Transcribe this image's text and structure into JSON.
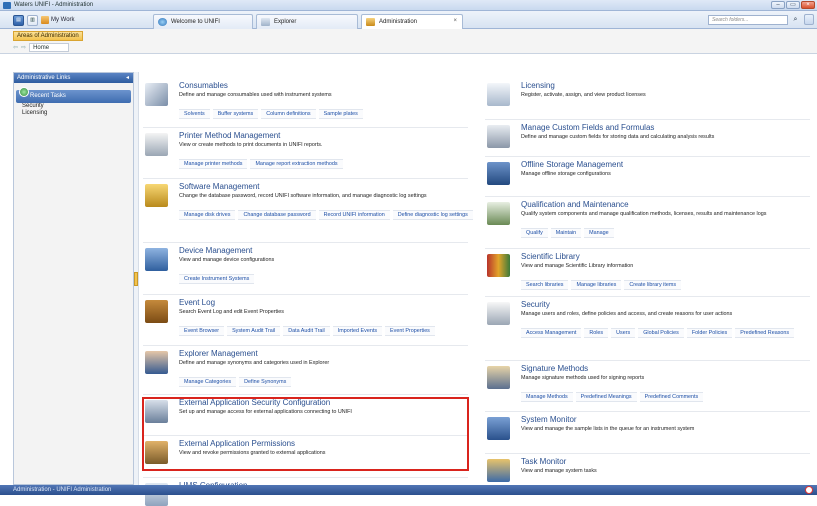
{
  "window": {
    "title": "Waters UNIFI - Administration",
    "controls": [
      "–",
      "▭",
      "×"
    ]
  },
  "toolbar": {
    "view_btn": "▤",
    "layout_btn": "▥",
    "my_work_label": "My Work",
    "tabs": [
      {
        "label": "Welcome to UNIFI"
      },
      {
        "label": "Explorer"
      },
      {
        "label": "Administration"
      }
    ],
    "tab_close": "×",
    "search_placeholder": "Search folders..."
  },
  "areas": {
    "label": "Areas of Administration",
    "back": "⇦",
    "forward": "⇨",
    "home": "Home"
  },
  "sidebar": {
    "header": "Administrative Links",
    "pin": "◂",
    "recent_tasks": "Recent Tasks",
    "links": [
      "Security",
      "Licensing"
    ]
  },
  "sections_left": [
    {
      "title": "Consumables",
      "desc": "Define and manage consumables used with instrument systems",
      "links": [
        "Solvents",
        "Buffer systems",
        "Column definitions",
        "Sample plates"
      ]
    },
    {
      "title": "Printer Method Management",
      "desc": "View or create methods to print documents in UNIFI reports.",
      "links": [
        "Manage printer methods",
        "Manage report extraction methods"
      ]
    },
    {
      "title": "Software Management",
      "desc": "Change the database password, record UNIFI software information, and manage diagnostic log settings",
      "links": [
        "Manage disk drives",
        "Change database password",
        "Record UNIFI information",
        "Define diagnostic log settings"
      ]
    },
    {
      "title": "Device Management",
      "desc": "View and manage device configurations",
      "links": [
        "Create Instrument Systems"
      ]
    },
    {
      "title": "Event Log",
      "desc": "Search Event Log and edit Event Properties",
      "links": [
        "Event Browser",
        "System Audit Trail",
        "Data Audit Trail",
        "Imported Events",
        "Event Properties"
      ]
    },
    {
      "title": "Explorer Management",
      "desc": "Define and manage synonyms and categories used in Explorer",
      "links": [
        "Manage Categories",
        "Define Synonyms"
      ]
    },
    {
      "title": "External Application Security Configuration",
      "desc": "Set up and manage access for external applications connecting to UNIFI",
      "links": []
    },
    {
      "title": "External Application Permissions",
      "desc": "View and revoke permissions granted to external applications",
      "links": []
    },
    {
      "title": "LIMS Configuration",
      "desc": "",
      "links": []
    }
  ],
  "sections_right": [
    {
      "title": "Licensing",
      "desc": "Register, activate, assign, and view product licenses",
      "links": []
    },
    {
      "title": "Manage Custom Fields and Formulas",
      "desc": "Define and manage custom fields for storing data and calculating analysis results",
      "links": []
    },
    {
      "title": "Offline Storage Management",
      "desc": "Manage offline storage configurations",
      "links": []
    },
    {
      "title": "Qualification and Maintenance",
      "desc": "Qualify system components and manage qualification methods, licenses, results and maintenance logs",
      "links": [
        "Qualify",
        "Maintain",
        "Manage"
      ]
    },
    {
      "title": "Scientific Library",
      "desc": "View and manage Scientific Library information",
      "links": [
        "Search libraries",
        "Manage libraries",
        "Create library items"
      ]
    },
    {
      "title": "Security",
      "desc": "Manage users and roles, define policies and access, and create reasons for user actions",
      "links": [
        "Access Management",
        "Roles",
        "Users",
        "Global Policies",
        "Folder Policies",
        "Predefined Reasons"
      ]
    },
    {
      "title": "Signature Methods",
      "desc": "Manage signature methods used for signing reports",
      "links": [
        "Manage Methods",
        "Predefined Meanings",
        "Predefined Comments"
      ]
    },
    {
      "title": "System Monitor",
      "desc": "View and manage the sample lists in the queue for an instrument system",
      "links": []
    },
    {
      "title": "Task Monitor",
      "desc": "View and manage system tasks",
      "links": []
    }
  ],
  "statusbar": {
    "text": "Administration - UNIFI Administration"
  }
}
